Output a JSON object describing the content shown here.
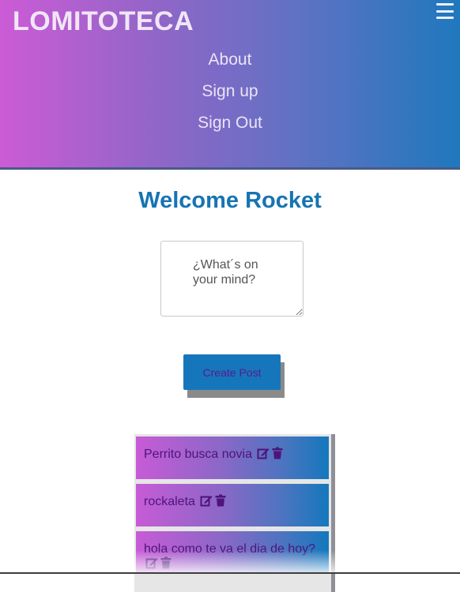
{
  "header": {
    "logo": "LOMITOTECA",
    "nav": [
      "About",
      "Sign up",
      "Sign Out"
    ],
    "menu_icon": "hamburger-menu-icon"
  },
  "main": {
    "welcome": "Welcome Rocket",
    "post_input": {
      "placeholder": "¿What´s on your mind?",
      "value": ""
    },
    "create_button": "Create Post"
  },
  "posts": [
    {
      "text": "Perrito busca novia",
      "icons": [
        "edit-icon",
        "trash-icon"
      ]
    },
    {
      "text": "rockaleta",
      "icons": [
        "edit-icon",
        "trash-icon"
      ]
    },
    {
      "text": "hola como te va el dia de hoy?",
      "icons": [
        "edit-icon",
        "trash-icon"
      ]
    }
  ],
  "colors": {
    "header_gradient": [
      "#cc5bd6",
      "#1f78bd"
    ],
    "accent": "#1674b3",
    "post_text": "#4e147a"
  }
}
